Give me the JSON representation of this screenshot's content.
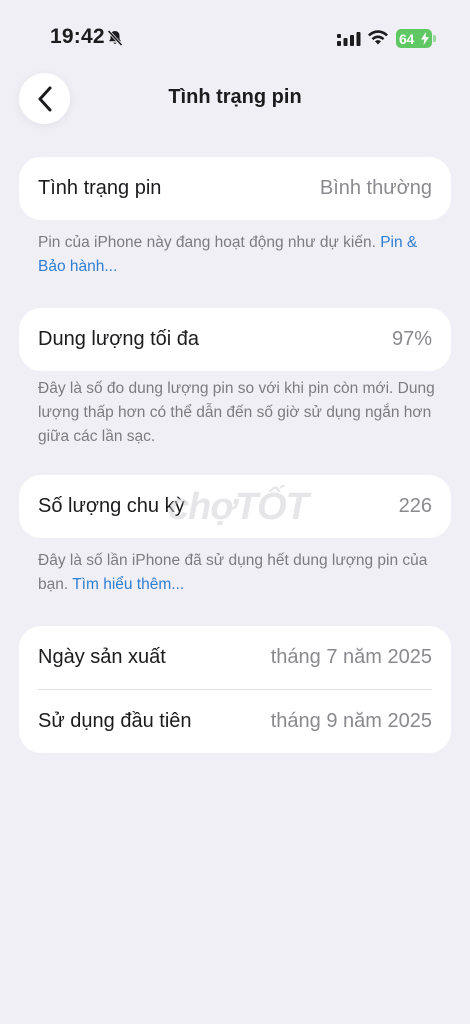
{
  "status_bar": {
    "time": "19:42",
    "battery_level": "64",
    "icons": [
      "bell-slash-icon",
      "signal-icon",
      "wifi-icon",
      "battery-charging-icon"
    ]
  },
  "nav": {
    "title": "Tình trạng pin",
    "back_icon": "chevron-left-icon"
  },
  "battery_health": {
    "label": "Tình trạng pin",
    "value": "Bình thường",
    "footnote": "Pin của iPhone này đang hoạt động như dự kiến. ",
    "footnote_link": "Pin & Bảo hành..."
  },
  "max_capacity": {
    "label": "Dung lượng tối đa",
    "value": "97%",
    "footnote": "Đây là số đo dung lượng pin so với khi pin còn mới. Dung lượng thấp hơn có thể dẫn đến số giờ sử dụng ngắn hơn giữa các lần sạc."
  },
  "cycle_count": {
    "label": "Số lượng chu kỳ",
    "value": "226",
    "footnote": "Đây là số lần iPhone đã sử dụng hết dung lượng pin của bạn. ",
    "footnote_link": "Tìm hiểu thêm..."
  },
  "dates": {
    "manufacture_label": "Ngày sản xuất",
    "manufacture_value": "tháng 7 năm 2025",
    "first_use_label": "Sử dụng đầu tiên",
    "first_use_value": "tháng 9 năm 2025"
  },
  "watermark": "chợTỐT",
  "colors": {
    "background": "#f0eff5",
    "card": "#ffffff",
    "link": "#2f7fd3",
    "battery": "#5fc863",
    "secondary_text": "#8a8a8e"
  }
}
